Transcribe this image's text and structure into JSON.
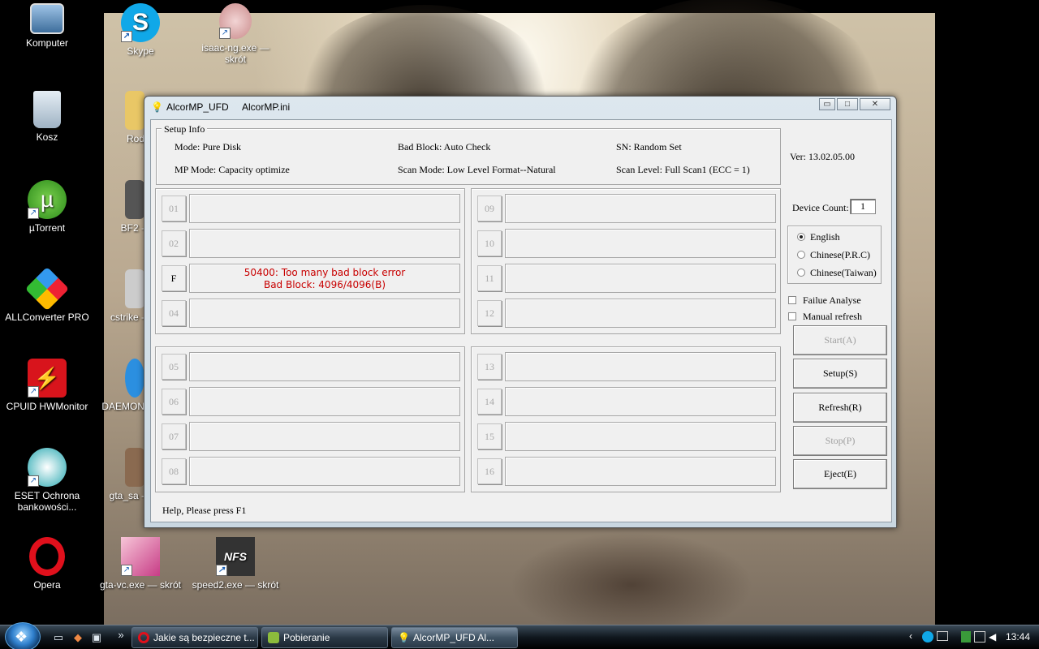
{
  "desktop": {
    "icons": [
      {
        "label": "Komputer"
      },
      {
        "label": "Kosz"
      },
      {
        "label": "µTorrent"
      },
      {
        "label": "ALLConverter PRO"
      },
      {
        "label": "CPUID HWMonitor"
      },
      {
        "label": "ESET Ochrona bankowości..."
      },
      {
        "label": "Opera"
      },
      {
        "label": "Skype"
      },
      {
        "label": "isaac-ng.exe — skrót"
      },
      {
        "label": "Rod"
      },
      {
        "label": "BF2 -"
      },
      {
        "label": "cstrike -"
      },
      {
        "label": "DAEMON"
      },
      {
        "label": "gta_sa -"
      },
      {
        "label": "gta-vc.exe — skrót"
      },
      {
        "label": "speed2.exe — skrót"
      }
    ]
  },
  "window": {
    "title_app": "AlcorMP_UFD",
    "title_file": "AlcorMP.ini",
    "controls": {
      "minimize": "▭",
      "maximize": "□",
      "close": "✕"
    }
  },
  "setup_info": {
    "title": "Setup Info",
    "mode": "Mode: Pure Disk",
    "bad_block": "Bad Block: Auto Check",
    "sn": "SN: Random Set",
    "mp_mode": "MP Mode: Capacity optimize",
    "scan_mode": "Scan Mode: Low Level Format--Natural",
    "scan_level": "Scan Level: Full Scan1 (ECC = 1)"
  },
  "version": "Ver: 13.02.05.00",
  "device_count": {
    "label": "Device Count:",
    "value": "1"
  },
  "slots": [
    {
      "id": "01"
    },
    {
      "id": "02"
    },
    {
      "id": "F"
    },
    {
      "id": "04"
    },
    {
      "id": "05"
    },
    {
      "id": "06"
    },
    {
      "id": "07"
    },
    {
      "id": "08"
    },
    {
      "id": "09"
    },
    {
      "id": "10"
    },
    {
      "id": "11"
    },
    {
      "id": "12"
    },
    {
      "id": "13"
    },
    {
      "id": "14"
    },
    {
      "id": "15"
    },
    {
      "id": "16"
    }
  ],
  "error": {
    "line1": "50400: Too many bad block error",
    "line2": "Bad Block: 4096/4096(B)"
  },
  "language": {
    "options": [
      "English",
      "Chinese(P.R.C)",
      "Chinese(Taiwan)"
    ],
    "selected": "English"
  },
  "checkboxes": {
    "failure_analyse": "Failue Analyse",
    "manual_refresh": "Manual refresh"
  },
  "buttons": {
    "start": "Start(A)",
    "setup": "Setup(S)",
    "refresh": "Refresh(R)",
    "stop": "Stop(P)",
    "eject": "Eject(E)"
  },
  "help_text": "Help, Please press F1",
  "taskbar": {
    "tasks": [
      {
        "label": "Jakie są bezpieczne t..."
      },
      {
        "label": "Pobieranie"
      },
      {
        "label": "AlcorMP_UFD      Al..."
      }
    ],
    "clock": "13:44",
    "overflow": "»",
    "tray_chevron": "‹"
  },
  "colors": {
    "error_red": "#c80000",
    "disabled_gray": "#a0a0a0"
  }
}
